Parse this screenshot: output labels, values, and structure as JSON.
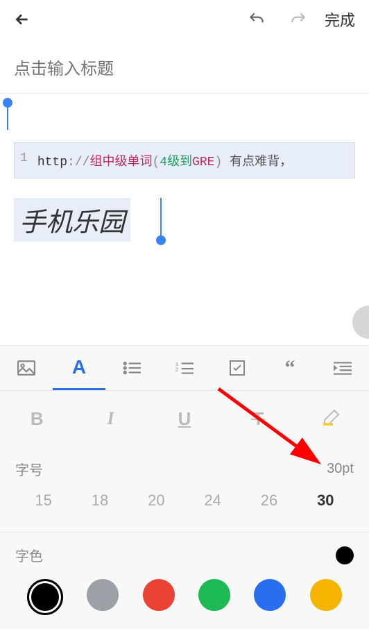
{
  "topbar": {
    "done_label": "完成"
  },
  "editor": {
    "title_placeholder": "点击输入标题",
    "code": {
      "line_no": "1",
      "http": "http",
      "colon1": ":",
      "slashes": "//",
      "mid": "组中级单词",
      "lp": "(",
      "level": "4级到",
      "gre": "GRE",
      "rp": ")",
      "rest": "  有点难背，"
    },
    "big_text": "手机乐园"
  },
  "toolbar": {
    "fmt": {
      "bold": "B",
      "italic": "I",
      "underline": "U",
      "strike": "T"
    },
    "font_size": {
      "label": "字号",
      "value": "30pt",
      "options": [
        "15",
        "18",
        "20",
        "24",
        "26",
        "30"
      ],
      "selected": "30"
    },
    "color": {
      "label": "字色",
      "current": "#000000",
      "swatches": [
        "#000000",
        "#9aa0a6",
        "#ea4335",
        "#1db954",
        "#2a6ef0",
        "#f4b400"
      ]
    }
  }
}
